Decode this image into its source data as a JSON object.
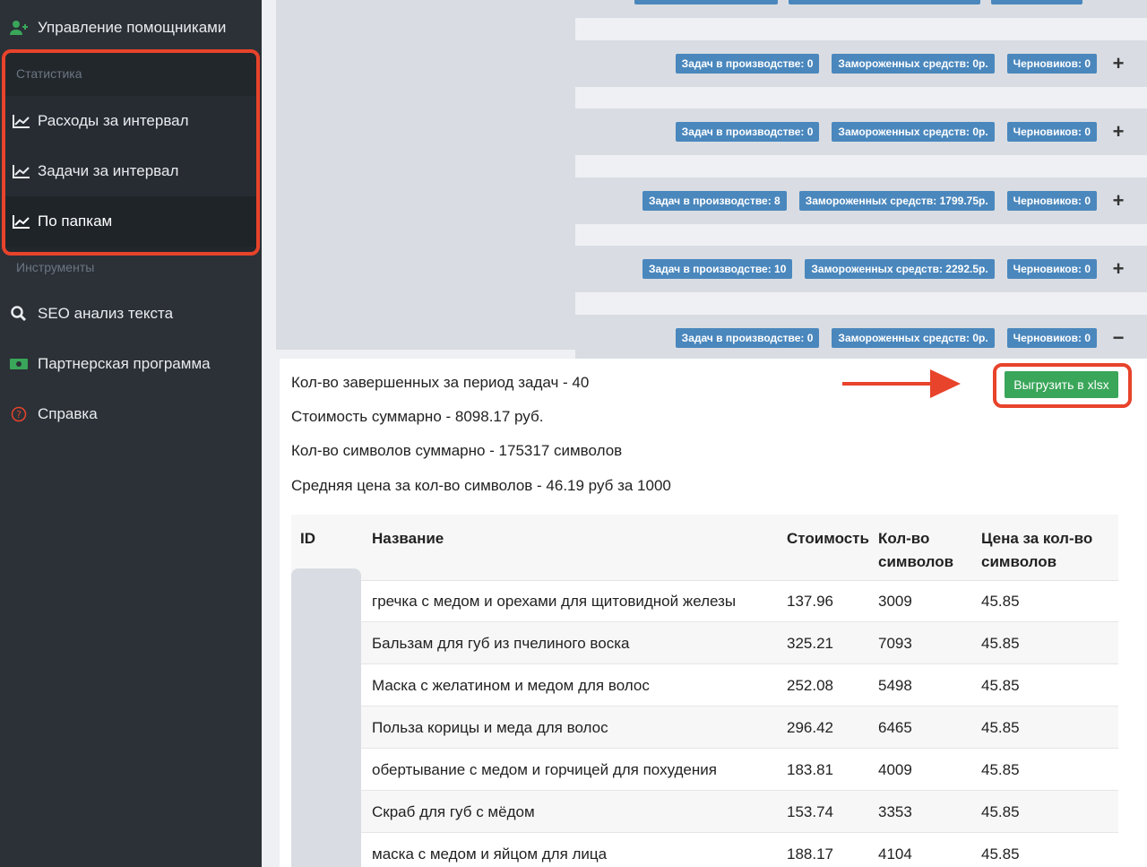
{
  "sidebar": {
    "top_item": {
      "label": "Управление помощниками",
      "icon": "user-plus-icon"
    },
    "stats_section": "Статистика",
    "stats_items": [
      {
        "label": "Расходы за интервал",
        "icon": "line-chart-icon"
      },
      {
        "label": "Задачи за интервал",
        "icon": "line-chart-icon"
      },
      {
        "label": "По папкам",
        "icon": "line-chart-icon",
        "active": true
      }
    ],
    "tools_section": "Инструменты",
    "tools_items": [
      {
        "label": "SEO анализ текста",
        "icon": "search-icon"
      },
      {
        "label": "Партнерская программа",
        "icon": "money-icon"
      },
      {
        "label": "Справка",
        "icon": "help-circle-icon"
      }
    ]
  },
  "folders": [
    {
      "in_production": "Задач в производстве: 0",
      "frozen": "Замороженных средств: 0р.",
      "drafts": "Черновиков: 0",
      "toggle": "+"
    },
    {
      "in_production": "Задач в производстве: 0",
      "frozen": "Замороженных средств: 0р.",
      "drafts": "Черновиков: 0",
      "toggle": "+"
    },
    {
      "in_production": "Задач в производстве: 8",
      "frozen": "Замороженных средств: 1799.75р.",
      "drafts": "Черновиков: 0",
      "toggle": "+"
    },
    {
      "in_production": "Задач в производстве: 10",
      "frozen": "Замороженных средств: 2292.5р.",
      "drafts": "Черновиков: 0",
      "toggle": "+"
    },
    {
      "in_production": "Задач в производстве: 0",
      "frozen": "Замороженных средств: 0р.",
      "drafts": "Черновиков: 0",
      "toggle": "−"
    }
  ],
  "summary": {
    "completed": "Кол-во завершенных за период задач - 40",
    "total_cost": "Стоимость суммарно - 8098.17 руб.",
    "total_chars": "Кол-во символов суммарно - 175317 символов",
    "avg_price": "Средняя цена за кол-во символов - 46.19 руб за 1000"
  },
  "export_button": "Выгрузить в xlsx",
  "table": {
    "headers": {
      "id": "ID",
      "name": "Название",
      "cost": "Стоимость",
      "chars_line1": "Кол-во",
      "chars_line2": "символов",
      "price_line1": "Цена за кол-во",
      "price_line2": "символов"
    },
    "rows": [
      {
        "name": "гречка с медом и орехами для щитовидной железы",
        "cost": "137.96",
        "chars": "3009",
        "price": "45.85"
      },
      {
        "name": "Бальзам для губ из пчелиного воска",
        "cost": "325.21",
        "chars": "7093",
        "price": "45.85"
      },
      {
        "name": "Маска с желатином и медом для волос",
        "cost": "252.08",
        "chars": "5498",
        "price": "45.85"
      },
      {
        "name": "Польза корицы и меда для волос",
        "cost": "296.42",
        "chars": "6465",
        "price": "45.85"
      },
      {
        "name": "обертывание с медом и горчицей для похудения",
        "cost": "183.81",
        "chars": "4009",
        "price": "45.85"
      },
      {
        "name": "Скраб для губ с мёдом",
        "cost": "153.74",
        "chars": "3353",
        "price": "45.85"
      },
      {
        "name": "маска с медом и яйцом для лица",
        "cost": "188.17",
        "chars": "4104",
        "price": "45.85"
      }
    ]
  },
  "colors": {
    "badge": "#4a87bd",
    "export": "#3aa65a",
    "highlight": "#e8432b",
    "sidebar": "#2b3137"
  }
}
